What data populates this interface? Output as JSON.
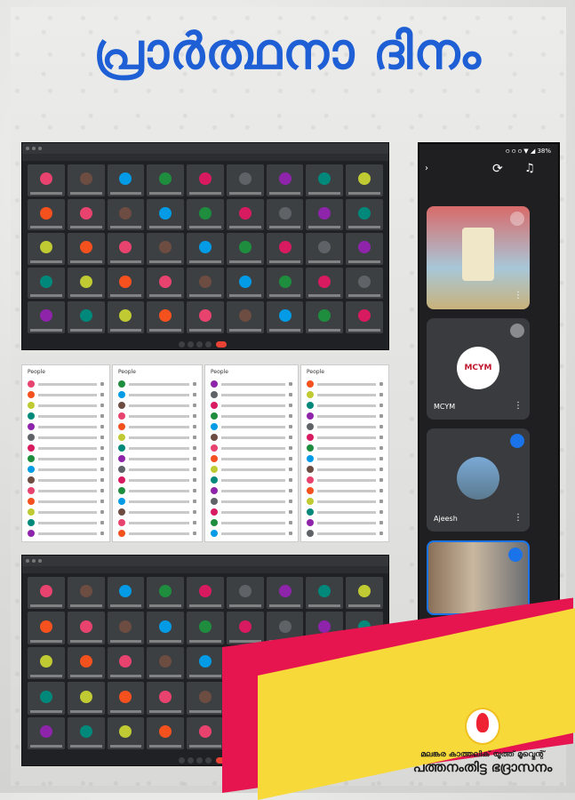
{
  "poster": {
    "title": "പ്രാർത്ഥനാ ദിനം",
    "org_line1": "മലങ്കര കാത്തലിക് യൂത്ത് മൂവ്മെന്റ്",
    "org_line2": "പത്തനംതിട്ട ഭദ്രാസനം"
  },
  "phone": {
    "status": "ഠ ഠ ഠ ▼ ◢ 38%",
    "participants": [
      {
        "name": "",
        "type": "video",
        "icon": "mic-off-icon"
      },
      {
        "name": "MCYM",
        "type": "logo",
        "logo_text": "MCYM",
        "icon": "mic-off-icon"
      },
      {
        "name": "Ajeesh",
        "type": "avatar",
        "icon": "speaking-icon"
      },
      {
        "name": "",
        "type": "video",
        "icon": "speaking-icon"
      }
    ]
  },
  "people_panels": [
    {
      "title": "People"
    },
    {
      "title": "People"
    },
    {
      "title": "People"
    },
    {
      "title": "People"
    }
  ],
  "colors": {
    "title_blue": "#1f5fd6",
    "accent_red": "#e6154f",
    "accent_yellow": "#f7d93a",
    "meet_bg": "#202124",
    "tile_bg": "#3c4043",
    "end_call": "#ea4335"
  }
}
